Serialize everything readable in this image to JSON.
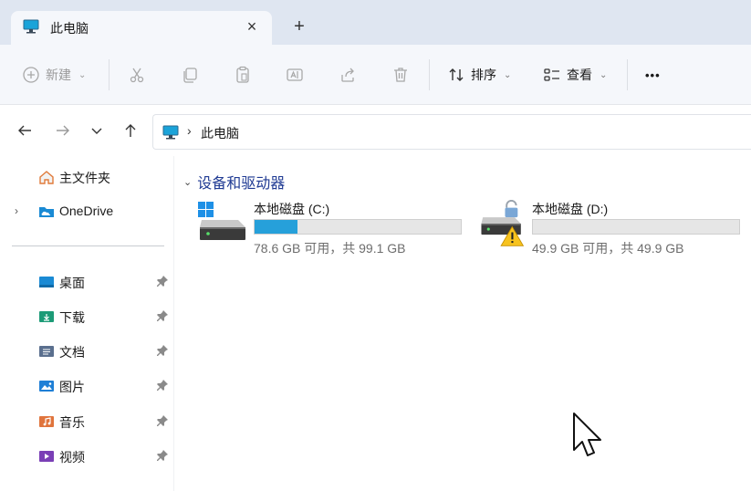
{
  "tab": {
    "title": "此电脑",
    "close_label": "×",
    "new_tab_label": "+"
  },
  "toolbar": {
    "new_label": "新建",
    "sort_label": "排序",
    "view_label": "查看",
    "more_label": "•••"
  },
  "address": {
    "separator": "›",
    "path": "此电脑"
  },
  "sidebar": {
    "home": "主文件夹",
    "onedrive": "OneDrive",
    "expander": "›",
    "pinned": [
      {
        "label": "桌面",
        "icon": "desktop-folder-icon",
        "color": "#1a8ad4"
      },
      {
        "label": "下载",
        "icon": "downloads-folder-icon",
        "color": "#1c9b77"
      },
      {
        "label": "文档",
        "icon": "documents-folder-icon",
        "color": "#5a6f8e"
      },
      {
        "label": "图片",
        "icon": "pictures-folder-icon",
        "color": "#1f7fd6"
      },
      {
        "label": "音乐",
        "icon": "music-folder-icon",
        "color": "#e0743c"
      },
      {
        "label": "视频",
        "icon": "videos-folder-icon",
        "color": "#7a3fb6"
      }
    ]
  },
  "content": {
    "group_title": "设备和驱动器",
    "drives": [
      {
        "name": "本地磁盘 (C:)",
        "info": "78.6 GB 可用，共 99.1 GB",
        "used_fraction": 0.207,
        "icon": "windows-drive-icon"
      },
      {
        "name": "本地磁盘 (D:)",
        "info": "49.9 GB 可用，共 49.9 GB",
        "used_fraction": 0.0,
        "icon": "locked-drive-warning-icon"
      }
    ]
  },
  "colors": {
    "accent": "#26a0da",
    "group_header": "#1f3a93"
  }
}
